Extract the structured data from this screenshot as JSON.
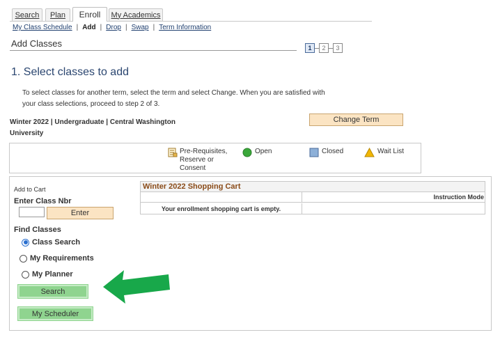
{
  "tabs": [
    {
      "label": "Search",
      "active": false
    },
    {
      "label": "Plan",
      "active": false
    },
    {
      "label": "Enroll",
      "active": true
    },
    {
      "label": "My Academics",
      "active": false
    }
  ],
  "subnav": {
    "my_class_schedule": "My Class Schedule",
    "add": "Add",
    "drop": "Drop",
    "swap": "Swap",
    "term_information": "Term Information",
    "separator": "|"
  },
  "page_title": "Add Classes",
  "steps": [
    "1",
    "2",
    "3"
  ],
  "heading": "1.  Select classes to add",
  "intro": "To select classes for another term, select the term and select Change.  When you are satisfied with your class selections, proceed to step 2 of 3.",
  "term_label": "Winter 2022 | Undergraduate | Central Washington University",
  "change_term_button": "Change Term",
  "legend": {
    "prereq": "Pre-Requisites, Reserve or Consent",
    "open": "Open",
    "closed": "Closed",
    "wait_list": "Wait List"
  },
  "add_to_cart": {
    "label": "Add to Cart",
    "class_nbr_label": "Enter Class Nbr",
    "class_nbr_value": "",
    "enter_button": "Enter"
  },
  "find_classes": {
    "label": "Find Classes",
    "options": [
      {
        "label": "Class Search",
        "selected": true
      },
      {
        "label": "My Requirements",
        "selected": false
      },
      {
        "label": "My Planner",
        "selected": false
      }
    ],
    "search_button": "Search",
    "scheduler_button": "My Scheduler"
  },
  "cart": {
    "title": "Winter 2022 Shopping Cart",
    "column_instruction_mode": "Instruction Mode",
    "empty_message": "Your enrollment shopping cart is empty."
  },
  "colors": {
    "open": "#3aa83a",
    "closed": "#8db0d8",
    "wait_list": "#f2b705",
    "arrow": "#18a84a",
    "button_tan": "#fbe4c3",
    "button_green": "#8fd48f",
    "heading": "#2b4670",
    "cart_title": "#8a4b18"
  }
}
